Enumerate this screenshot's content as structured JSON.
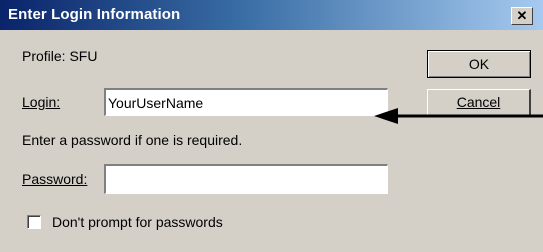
{
  "window": {
    "title": "Enter Login Information",
    "close_glyph": "✕"
  },
  "profile": {
    "text": "Profile: SFU"
  },
  "login": {
    "label": "Login:",
    "value": "YourUserName"
  },
  "info": {
    "text": "Enter a password if one is required."
  },
  "password": {
    "label": "Password:",
    "value": ""
  },
  "options": {
    "dont_prompt_label": "Don't prompt for passwords",
    "dont_prompt_checked": false
  },
  "buttons": {
    "ok_label": "OK",
    "cancel_label": "Cancel"
  },
  "annotation": {
    "arrow_icon": "arrow-left-icon",
    "arrow_color": "#000000"
  },
  "colors": {
    "title_bar_start": "#0a246a",
    "title_bar_end": "#a6caf0",
    "dialog_face": "#d4d0c8"
  }
}
